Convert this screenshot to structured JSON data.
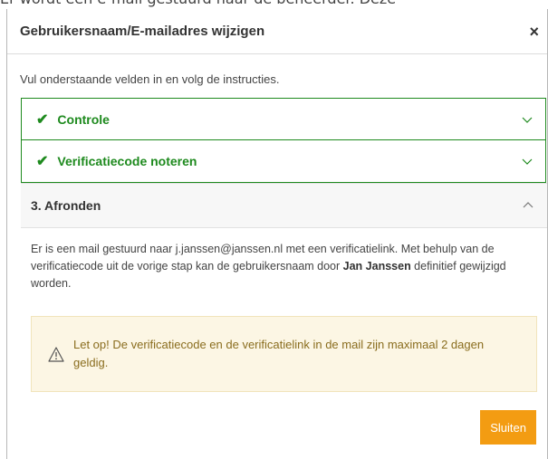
{
  "background": {
    "partial_text": "Er wordt een e-mail gestuurd naar de beheerder. Deze"
  },
  "modal": {
    "title": "Gebruikersnaam/E-mailadres wijzigen",
    "close_label": "×",
    "intro": "Vul onderstaande velden in en volg de instructies."
  },
  "steps": [
    {
      "label": "Controle",
      "state": "completed"
    },
    {
      "label": "Verificatiecode noteren",
      "state": "completed"
    },
    {
      "label": "3. Afronden",
      "state": "expanded"
    }
  ],
  "step3": {
    "text_1": "Er is een mail gestuurd naar j.janssen@janssen.nl met een verificatielink. Met behulp van de verificatiecode uit de vorige stap kan de gebruikersnaam door ",
    "name": "Jan Janssen",
    "text_2": " definitief gewijzigd worden.",
    "alert": "Let op! De verificatiecode en de verificatielink in de mail zijn maximaal 2 dagen geldig."
  },
  "footer": {
    "close_button": "Sluiten"
  },
  "colors": {
    "success": "#1e8a1e",
    "warning_bg": "#fcf6e4",
    "warning_text": "#8a6d1e",
    "primary_button": "#f39c12"
  }
}
